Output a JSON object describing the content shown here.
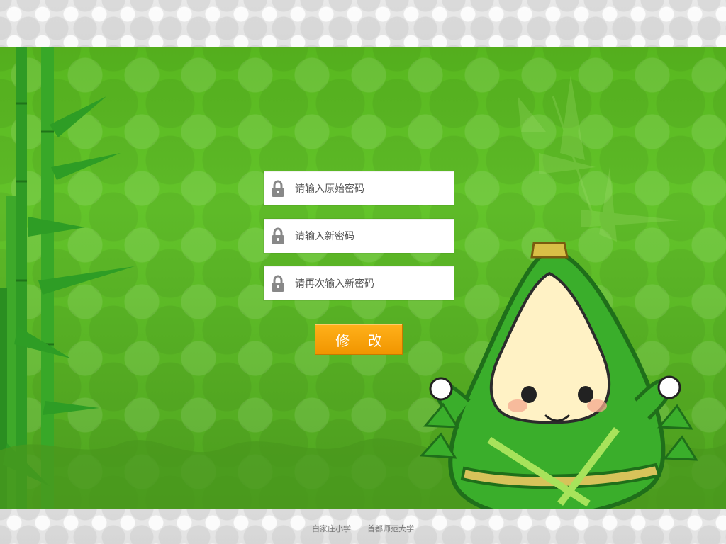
{
  "form": {
    "original_password_placeholder": "请输入原始密码",
    "new_password_placeholder": "请输入新密码",
    "confirm_password_placeholder": "请再次输入新密码",
    "submit_label": "修 改"
  },
  "icons": {
    "lock": "lock-icon"
  },
  "footer": {
    "school": "白家庄小学",
    "university": "首都师范大学"
  },
  "colors": {
    "background_green": "#5dbb24",
    "button_orange": "#f39b00",
    "field_white": "#ffffff"
  }
}
